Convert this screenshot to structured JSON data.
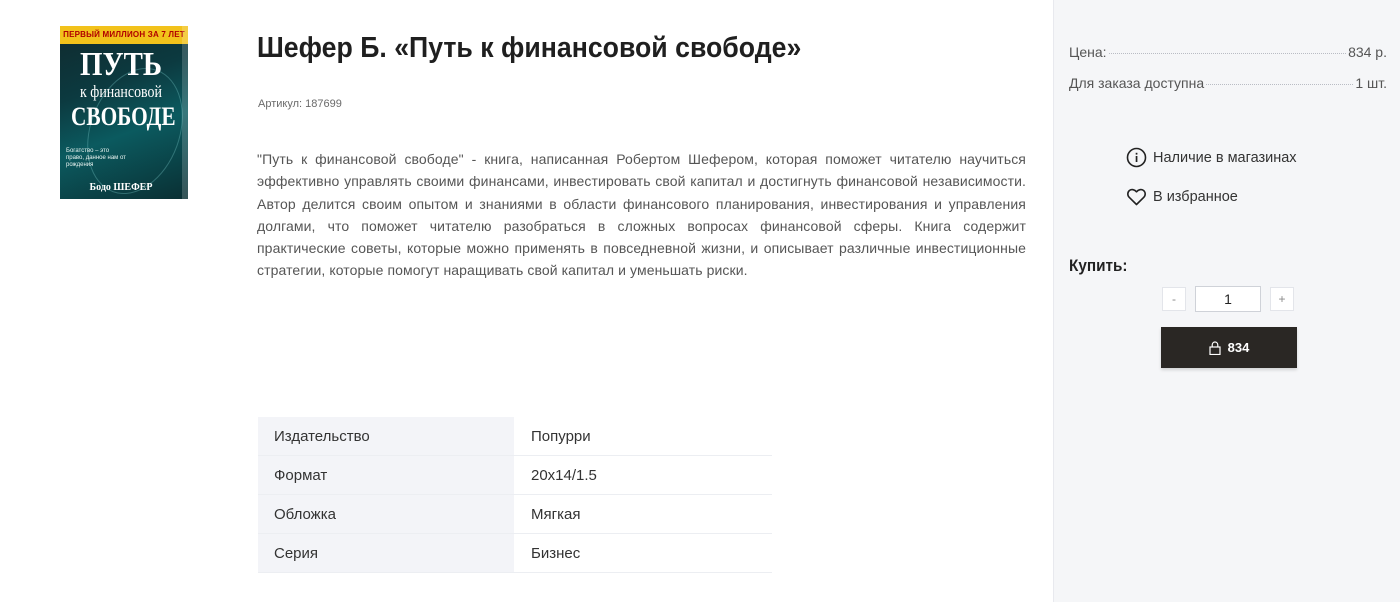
{
  "cover": {
    "band": "ПЕРВЫЙ МИЛЛИОН ЗА 7 ЛЕТ",
    "title_line1": "ПУТЬ",
    "title_line2": "к финансовой",
    "title_line3": "СВОБОДЕ",
    "tagline": "Богатство – это право, данное нам от рождения",
    "author": "Бодо ШЕФЕР"
  },
  "product": {
    "title": "Шефер Б. «Путь к финансовой свободе»",
    "sku": "Артикул: 187699",
    "description": "\"Путь к финансовой свободе\" - книга, написанная Робертом Шефером, которая поможет читателю научиться эффективно управлять своими финансами, инвестировать свой капитал и достигнуть финансовой независимости. Автор делится своим опытом и знаниями в области финансового планирования, инвестирования и управления долгами, что поможет читателю разобраться в сложных вопросах финансовой сферы. Книга содержит практические советы, которые можно применять в повседневной жизни, и описывает различные инвестиционные стратегии, которые помогут наращивать свой капитал и уменьшать риски."
  },
  "specs": [
    {
      "key": "Издательство",
      "value": "Попурри"
    },
    {
      "key": "Формат",
      "value": "20x14/1.5"
    },
    {
      "key": "Обложка",
      "value": "Мягкая"
    },
    {
      "key": "Серия",
      "value": "Бизнес"
    }
  ],
  "panel": {
    "price_label": "Цена:",
    "price_value": "834 р.",
    "stock_label": "Для заказа доступна",
    "stock_value": "1 шт.",
    "stores_link": "Наличие в магазинах",
    "favorite_link": "В избранное",
    "buy_label": "Купить:",
    "qty_minus": "-",
    "qty_plus": "+",
    "qty_value": "1",
    "buy_button": "834"
  }
}
